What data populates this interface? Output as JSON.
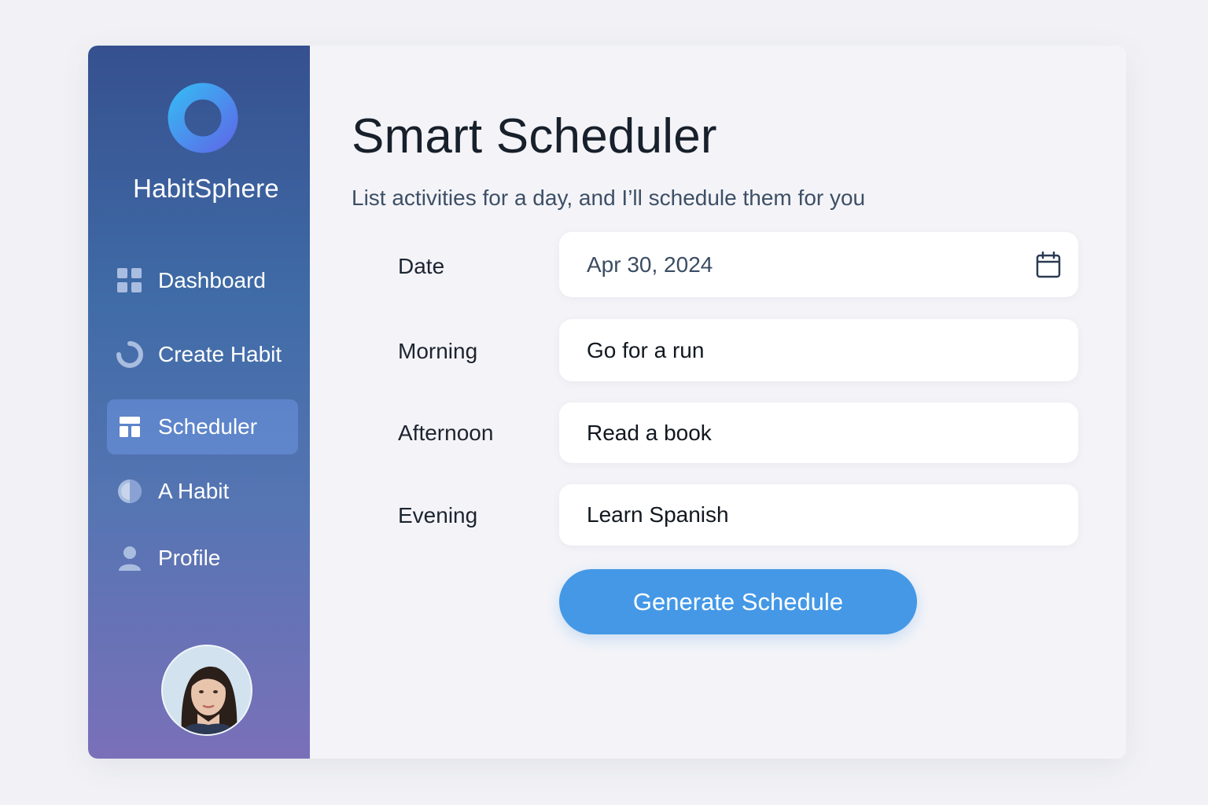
{
  "app": {
    "name": "HabitSphere",
    "brand_color": "#3f6ba6",
    "accent_color": "#4498e6"
  },
  "sidebar": {
    "logo_icon": "ring-logo-icon",
    "items": [
      {
        "label": "Dashboard",
        "icon": "grid-icon",
        "active": false
      },
      {
        "label": "Create Habit",
        "icon": "progress-circle-icon",
        "active": false
      },
      {
        "label": "Scheduler",
        "icon": "layout-icon",
        "active": true
      },
      {
        "label": "A Habit",
        "icon": "half-circle-icon",
        "active": false
      },
      {
        "label": "Profile",
        "icon": "person-icon",
        "active": false
      }
    ],
    "avatar_icon": "user-avatar"
  },
  "main": {
    "title": "Smart Scheduler",
    "subtitle": "List activities for a day, and I’ll schedule them for you",
    "form": {
      "date": {
        "label": "Date",
        "value": "Apr 30, 2024",
        "icon": "calendar-icon"
      },
      "morning": {
        "label": "Morning",
        "value": "Go for a run"
      },
      "afternoon": {
        "label": "Afternoon",
        "value": "Read a book"
      },
      "evening": {
        "label": "Evening",
        "value": "Learn Spanish"
      }
    },
    "generate_button": "Generate Schedule"
  }
}
